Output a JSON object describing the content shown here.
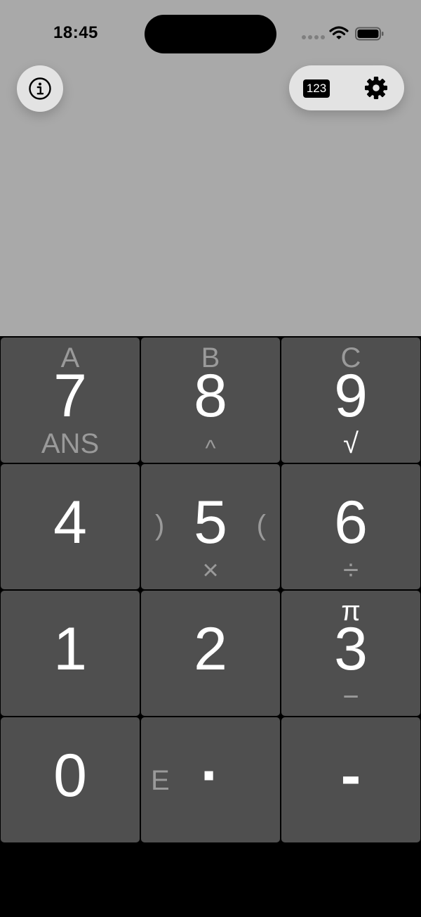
{
  "status_bar": {
    "time": "18:45",
    "wifi_icon": "wifi-icon",
    "battery_icon": "battery-icon"
  },
  "toolbar": {
    "info_icon": "info-icon",
    "number_toggle_label": "123",
    "settings_icon": "gear-icon"
  },
  "keypad": {
    "key_7": {
      "main": "7",
      "alt_top": "A",
      "alt_bottom": "ANS"
    },
    "key_8": {
      "main": "8",
      "alt_top": "B",
      "alt_bottom": "^"
    },
    "key_9": {
      "main": "9",
      "alt_top": "C",
      "alt_bottom": "√"
    },
    "key_4": {
      "main": "4"
    },
    "key_5": {
      "main": "5",
      "alt_left": ")",
      "alt_right": "(",
      "alt_bottom": "×"
    },
    "key_6": {
      "main": "6",
      "alt_bottom": "÷"
    },
    "key_1": {
      "main": "1"
    },
    "key_2": {
      "main": "2"
    },
    "key_3": {
      "main": "3",
      "alt_top": "π",
      "alt_bottom": "−"
    },
    "key_0": {
      "main": "0"
    },
    "key_dot": {
      "main": "·",
      "alt_left": "E"
    },
    "key_minus": {
      "main": "-"
    }
  },
  "colors": {
    "display_bg": "#a9a9a9",
    "key_bg": "#4f4f4f",
    "alt_text": "#9a9a9a",
    "toolbar_bg": "#e3e3e3"
  }
}
